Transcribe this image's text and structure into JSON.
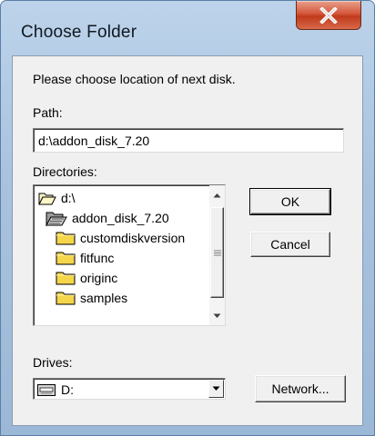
{
  "window": {
    "title": "Choose Folder",
    "close_glyph": "X"
  },
  "dialog": {
    "prompt": "Please choose location of next disk.",
    "path_label": "Path:",
    "path_value": "d:\\addon_disk_7.20",
    "directories_label": "Directories:",
    "directories": [
      {
        "label": "d:\\",
        "icon": "open-folder-icon",
        "level": 0
      },
      {
        "label": "addon_disk_7.20",
        "icon": "open-folder-icon",
        "level": 1
      },
      {
        "label": "customdiskversion",
        "icon": "folder-icon",
        "level": 2
      },
      {
        "label": "fitfunc",
        "icon": "folder-icon",
        "level": 2
      },
      {
        "label": "originc",
        "icon": "folder-icon",
        "level": 2
      },
      {
        "label": "samples",
        "icon": "folder-icon",
        "level": 2
      }
    ],
    "drives_label": "Drives:",
    "drive_value": "D:",
    "drive_icon": "drive-icon",
    "buttons": {
      "ok": "OK",
      "cancel": "Cancel",
      "network": "Network..."
    }
  },
  "colors": {
    "title_bar": "#a9c3df",
    "close_button": "#c8462a",
    "dialog_face": "#f0f0f0",
    "folder_yellow": "#f5d64a"
  }
}
